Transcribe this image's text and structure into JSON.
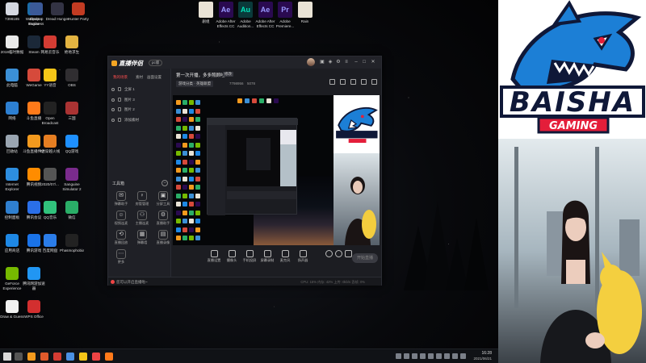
{
  "desktop": {
    "left_icons": [
      {
        "label": "7398185",
        "color": "#d5d8e0"
      },
      {
        "label": "Wallpaper Engine",
        "color": "#1b6ca8"
      },
      {
        "label": "2018临时数据",
        "color": "#eaeaea"
      },
      {
        "label": "Steam",
        "color": "#1b2838"
      },
      {
        "label": "此电脑",
        "color": "#3b8fd6"
      },
      {
        "label": "WeGame",
        "color": "#d64a3b"
      },
      {
        "label": "网络",
        "color": "#2d7fd2"
      },
      {
        "label": "斗鱼直播",
        "color": "#ff7a1a"
      },
      {
        "label": "回收站",
        "color": "#9aa5b1"
      },
      {
        "label": "斗鱼直播伴侣",
        "color": "#f39a1e"
      },
      {
        "label": "Internet Explorer",
        "color": "#2d8ee0"
      },
      {
        "label": "腾讯视频",
        "color": "#ff8c00"
      },
      {
        "label": "控制面板",
        "color": "#2f7fcf"
      },
      {
        "label": "腾讯会议",
        "color": "#2a6fe8"
      },
      {
        "label": "应用商店",
        "color": "#1e88e5"
      },
      {
        "label": "腾讯游戏",
        "color": "#1a73e8"
      },
      {
        "label": "GeForce Experience",
        "color": "#76b900"
      },
      {
        "label": "腾讯网游加速器",
        "color": "#2196f3"
      },
      {
        "label": "Draw & Guess",
        "color": "#f2f2f2"
      },
      {
        "label": "WPS Office",
        "color": "#d32f2f"
      }
    ],
    "col2_icons": [
      {
        "label": "Desktop Business",
        "color": "#3b5998"
      },
      {
        "label": "Dread Hunger",
        "color": "#334"
      },
      {
        "label": "Hunter Party",
        "color": "#c23b22"
      },
      {
        "label": "网易云音乐",
        "color": "#d43c33"
      },
      {
        "label": "绝地求生",
        "color": "#e3b341"
      },
      {
        "label": "YY语音",
        "color": "#f5c518"
      },
      {
        "label": "OBS",
        "color": "#302e31"
      },
      {
        "label": "Open Broadcast",
        "color": "#222"
      },
      {
        "label": "三国",
        "color": "#a33"
      },
      {
        "label": "CF穿越火线",
        "color": "#e67e22"
      },
      {
        "label": "QQ游戏",
        "color": "#1e90ff"
      },
      {
        "label": "2020/07/...",
        "color": "#555"
      },
      {
        "label": "Sanguine Simulator 2",
        "color": "#7a2b8c"
      },
      {
        "label": "QQ音乐",
        "color": "#31c27c"
      },
      {
        "label": "微信",
        "color": "#2aae67"
      },
      {
        "label": "百度网盘",
        "color": "#2b7de9"
      },
      {
        "label": "Phasmophobia",
        "color": "#222"
      }
    ],
    "top_icons": [
      {
        "label": "剧组",
        "color": "#e9e3d6",
        "text": ""
      },
      {
        "label": "Adobe After Effects CC ...",
        "color": "#2a0a50",
        "text": "Ae"
      },
      {
        "label": "Adobe Audition...",
        "color": "#0a3a3a",
        "text": "Au"
      },
      {
        "label": "Adobe After Effects CC 2...",
        "color": "#2a0a50",
        "text": "Ae"
      },
      {
        "label": "Adobe Premiere...",
        "color": "#2a0a50",
        "text": "Pr"
      },
      {
        "label": "Rain",
        "color": "#e9e3d6",
        "text": ""
      }
    ],
    "top_text_colors": {
      "Ae": "#9999ff",
      "Au": "#00e4bb",
      "Pr": "#9999ff"
    }
  },
  "taskbar": {
    "time": "16:28",
    "date": "2021/06/21",
    "pinned_colors": [
      "#f39a1e",
      "#e05a2b",
      "#d43c33",
      "#4a90e2",
      "#f5c518",
      "#e44",
      "#ff7a1a"
    ]
  },
  "app": {
    "logo_text": "直播伴侣",
    "badge": "pc版",
    "scene_tabs": [
      {
        "label": "我的场景",
        "active": true
      },
      {
        "label": "素材",
        "active": false
      },
      {
        "label": "画面设置",
        "active": false
      }
    ],
    "scenes": [
      {
        "label": "全屏 1"
      },
      {
        "label": "图片 3"
      },
      {
        "label": "图片 2"
      },
      {
        "label": "添加素材"
      }
    ],
    "tools_title": "工具箱",
    "tools": [
      {
        "label": "弹幕助手",
        "glyph": "✉"
      },
      {
        "label": "房管管理",
        "glyph": "♀"
      },
      {
        "label": "分屏工具",
        "glyph": "▣"
      },
      {
        "label": "视频连麦",
        "glyph": "☺"
      },
      {
        "label": "主播连麦",
        "glyph": "⚇"
      },
      {
        "label": "直播助手",
        "glyph": "⚙"
      },
      {
        "label": "直播回放",
        "glyph": "⟲"
      },
      {
        "label": "弹幕墙",
        "glyph": "▦"
      },
      {
        "label": "直播录像",
        "glyph": "▤"
      },
      {
        "label": "更多",
        "glyph": "⋯"
      }
    ],
    "live_title": "第一次开播，多多照顾哇~",
    "live_tag": "修改",
    "category": "游戏分类 · 英雄联盟",
    "stats_a": "7798956",
    "stats_b": "5078",
    "bottom_actions": [
      {
        "label": "直播设置"
      },
      {
        "label": "摄像头"
      },
      {
        "label": "手机投屏"
      },
      {
        "label": "屏幕录制"
      },
      {
        "label": "麦克风"
      },
      {
        "label": "扬声器"
      }
    ],
    "start_live": "开始直播",
    "status_text": "您可以开启直播啦~",
    "status_right": "CPU: 15%   内存: 42%   上传: 0kb/s   丢帧: 0%"
  },
  "overlay": {
    "logo_text": "BAISHA",
    "logo_subtext": "GAMING",
    "shark_color": "#1c7fd6",
    "accent_color": "#e41e3a"
  }
}
